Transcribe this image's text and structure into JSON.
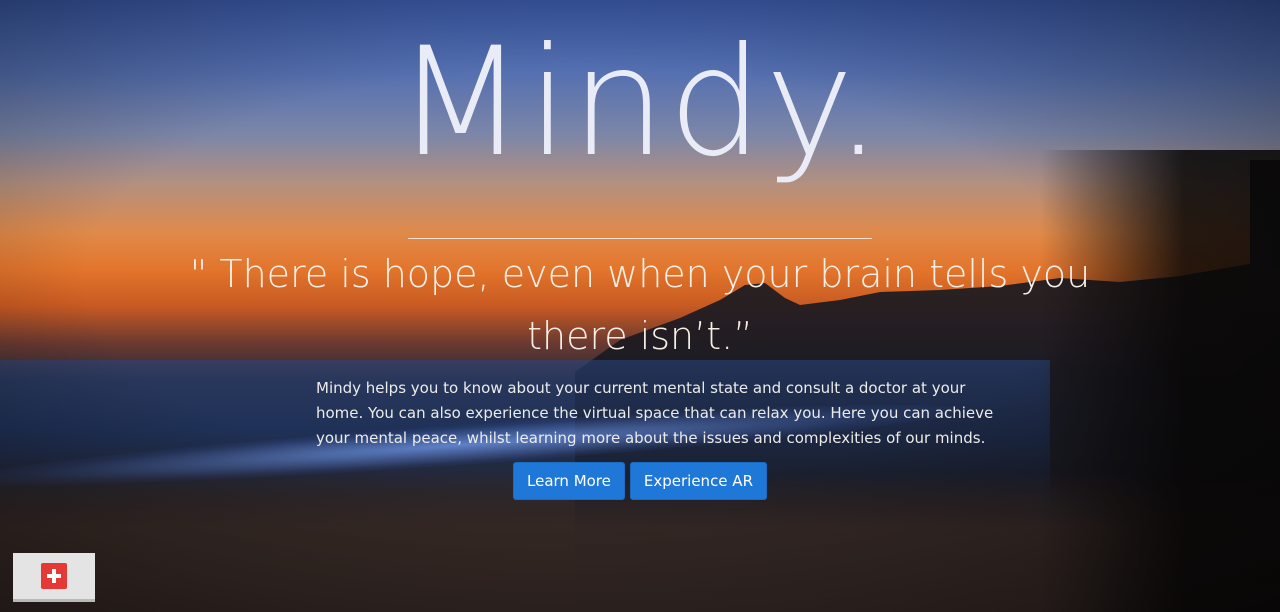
{
  "hero": {
    "brand": "Mindy.",
    "quote_line1": "\" There is hope, even when your brain tells you",
    "quote_line2": "there isn’t.”",
    "description_line1": "Mindy helps you to know about your current mental state and consult a doctor at your",
    "description_line2": "home. You can also experience the virtual space that can relax you. Here you can achieve",
    "description_line3": "your mental peace, whilst learning more about the issues and complexities of our minds.",
    "buttons": {
      "learn_more": "Learn More",
      "experience_ar": "Experience AR"
    }
  },
  "widget": {
    "icon": "medical-cross-icon"
  },
  "colors": {
    "button_bg": "#1f78d8",
    "widget_badge": "#e53935"
  }
}
